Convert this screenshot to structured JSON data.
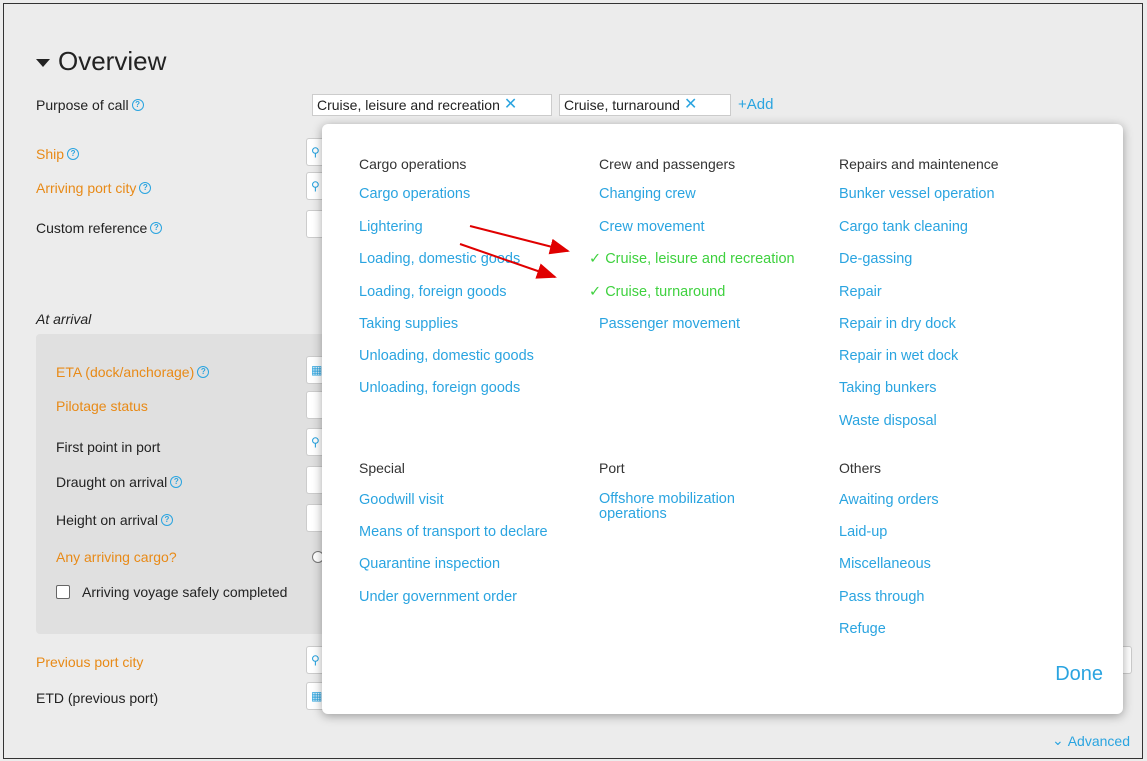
{
  "overview": {
    "title": "Overview",
    "purpose_label": "Purpose of call",
    "chips": [
      {
        "label": "Cruise, leisure and recreation"
      },
      {
        "label": "Cruise, turnaround"
      }
    ],
    "add_label": "+Add"
  },
  "fields": {
    "ship": "Ship",
    "arriving_port_city": "Arriving port city",
    "custom_reference": "Custom reference",
    "at_arrival": "At arrival",
    "eta": "ETA (dock/anchorage)",
    "pilotage_status": "Pilotage status",
    "first_point": "First point in port",
    "draught": "Draught on arrival",
    "height": "Height on arrival",
    "any_cargo": "Any arriving cargo?",
    "voyage_completed": "Arriving voyage safely completed",
    "previous_port_city": "Previous port city",
    "etd_previous": "ETD (previous port)"
  },
  "advanced_label": "Advanced",
  "popup": {
    "done_label": "Done",
    "groups": [
      {
        "title": "Cargo operations",
        "options": [
          "Cargo operations",
          "Lightering",
          "Loading, domestic goods",
          "Loading, foreign goods",
          "Taking supplies",
          "Unloading, domestic goods",
          "Unloading, foreign goods"
        ]
      },
      {
        "title": "Crew and passengers",
        "options": [
          "Changing crew",
          "Crew movement",
          "Cruise, leisure and recreation",
          "Cruise, turnaround",
          "Passenger movement"
        ]
      },
      {
        "title": "Repairs and maintenence",
        "options": [
          "Bunker vessel operation",
          "Cargo tank cleaning",
          "De-gassing",
          "Repair",
          "Repair in dry dock",
          "Repair in wet dock",
          "Taking bunkers",
          "Waste disposal"
        ]
      },
      {
        "title": "Special",
        "options": [
          "Goodwill visit",
          "Means of transport to declare",
          "Quarantine inspection",
          "Under government order"
        ]
      },
      {
        "title": "Port",
        "options": [
          "Offshore mobilization operations"
        ]
      },
      {
        "title": "Others",
        "options": [
          "Awaiting orders",
          "Laid-up",
          "Miscellaneous",
          "Pass through",
          "Refuge"
        ]
      }
    ],
    "selected_mark": "✓",
    "selected_color": "#3fd13f"
  },
  "colors": {
    "accent": "#2aa4e0",
    "required": "#e88a17",
    "annotation_arrow": "#e00000"
  }
}
